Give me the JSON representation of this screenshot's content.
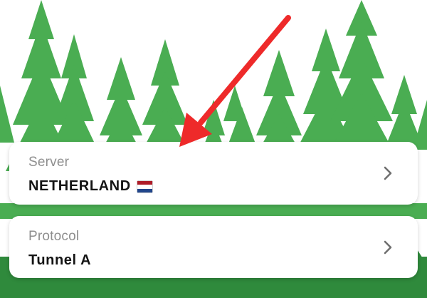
{
  "server": {
    "label": "Server",
    "value": "NETHERLAND",
    "flag": "netherlands-flag-icon"
  },
  "protocol": {
    "label": "Protocol",
    "value": "Tunnel A"
  },
  "icons": {
    "chevron": "chevron-right-icon",
    "annotation": "red-arrow-icon"
  },
  "colors": {
    "tree_dark": "#2f8a3c",
    "tree_light": "#4aad52",
    "arrow": "#ee2a2a",
    "flag_red": "#ae1c28",
    "flag_white": "#ffffff",
    "flag_blue": "#21468b"
  }
}
